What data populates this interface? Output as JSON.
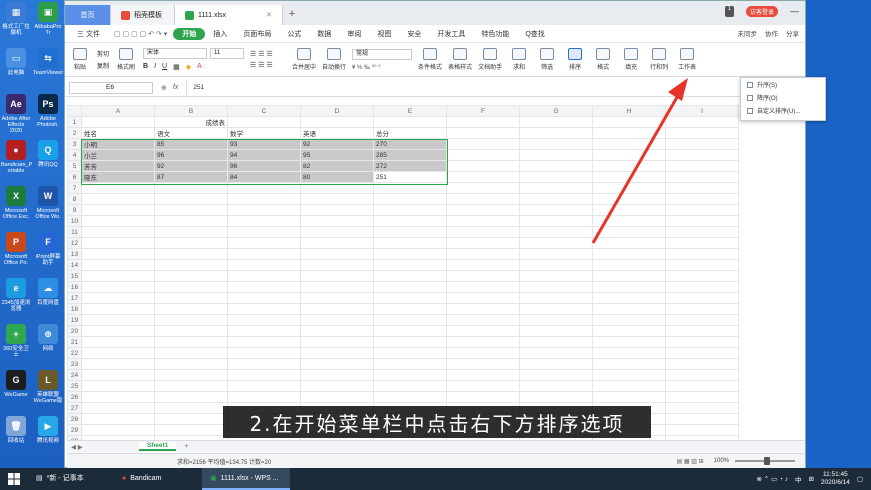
{
  "desktop_icons": [
    {
      "label": "格式工厂拉摄机",
      "color": "#3a7bd5",
      "glyph": "▦"
    },
    {
      "label": "AlibabaPro Tr",
      "color": "#2c9e4b",
      "glyph": "▣"
    },
    {
      "label": "此电脑",
      "color": "#4a90e2",
      "glyph": "▭"
    },
    {
      "label": "TeamViewer",
      "color": "#1f6fd1",
      "glyph": "⇆"
    },
    {
      "label": "Adobe After Effects 2020",
      "color": "#3b2a6e",
      "glyph": "Ae"
    },
    {
      "label": "Adobe Photosh.",
      "color": "#0b2a4a",
      "glyph": "Ps"
    },
    {
      "label": "Bandicam_P ortable",
      "color": "#b32020",
      "glyph": "●"
    },
    {
      "label": "腾讯QQ",
      "color": "#1aa0e8",
      "glyph": "Q"
    },
    {
      "label": "Microsoft Office Exc.",
      "color": "#1e7b3e",
      "glyph": "X"
    },
    {
      "label": "Microsoft Office Wo.",
      "color": "#1f55a8",
      "glyph": "W"
    },
    {
      "label": "Microsoft Office Po.",
      "color": "#c84a1c",
      "glyph": "P"
    },
    {
      "label": "iPoint屏幕助手",
      "color": "#2466d4",
      "glyph": "F"
    },
    {
      "label": "2345加速浏览器",
      "color": "#1b9be0",
      "glyph": "e"
    },
    {
      "label": "百度网盘",
      "color": "#2d8fe3",
      "glyph": "☁"
    },
    {
      "label": "360安全卫士",
      "color": "#2fa84f",
      "glyph": "+"
    },
    {
      "label": "网络",
      "color": "#3e8ad8",
      "glyph": "⊕"
    },
    {
      "label": "WeGame",
      "color": "#1d1d1d",
      "glyph": "G"
    },
    {
      "label": "英雄联盟 WeGame版",
      "color": "#6a5a2a",
      "glyph": "L"
    },
    {
      "label": "回收站",
      "color": "#7ea6d6",
      "glyph": "🗑"
    },
    {
      "label": "腾讯视频",
      "color": "#27a6e8",
      "glyph": "▶"
    }
  ],
  "app": {
    "tabs": [
      {
        "label": "首页"
      },
      {
        "label": "稻壳模板"
      },
      {
        "label": "1111.xlsx"
      }
    ],
    "window_badge": "1",
    "login_label": "访客登录",
    "menu": {
      "file": "三 文件",
      "items": [
        "开始",
        "插入",
        "页面布局",
        "公式",
        "数据",
        "审阅",
        "视图",
        "安全",
        "开发工具",
        "特色功能",
        "Q查找"
      ],
      "right": [
        "未同步",
        "协作",
        "分享"
      ]
    },
    "toolbar": {
      "paste": "粘贴",
      "cut": "剪切",
      "copy": "复制",
      "format_painter": "格式刷",
      "font": "宋体",
      "size": "11",
      "number_format": "常规",
      "merge": "合并居中",
      "wrap": "自动换行",
      "conditional": "条件格式",
      "table_style": "表格样式",
      "doc_helper": "文档助手",
      "sum": "求和",
      "filter": "筛选",
      "sort": "排序",
      "format": "格式",
      "fill": "填充",
      "row_col": "行和列",
      "worksheet": "工作表"
    },
    "formula_bar": {
      "cell_ref": "E6",
      "fx": "fx",
      "value": "251"
    }
  },
  "sheet": {
    "columns": [
      "A",
      "B",
      "C",
      "D",
      "E",
      "F",
      "G",
      "H",
      "I"
    ],
    "rows": [
      [
        "",
        "成绩表",
        "",
        "",
        "",
        "",
        "",
        "",
        ""
      ],
      [
        "姓名",
        "语文",
        "数学",
        "英语",
        "总分",
        "",
        "",
        "",
        ""
      ],
      [
        "小明",
        "85",
        "93",
        "92",
        "270",
        "",
        "",
        "",
        ""
      ],
      [
        "小兰",
        "96",
        "94",
        "95",
        "285",
        "",
        "",
        "",
        ""
      ],
      [
        "芳芳",
        "92",
        "96",
        "82",
        "272",
        "",
        "",
        "",
        ""
      ],
      [
        "晓东",
        "87",
        "84",
        "80",
        "251",
        "",
        "",
        "",
        ""
      ]
    ],
    "tab_name": "Sheet1"
  },
  "sort_menu": {
    "items": [
      "升序(S)",
      "降序(O)",
      "自定义排序(U)..."
    ]
  },
  "status_bar": {
    "summary": "求和=2156  平均值=134.75  计数=20",
    "zoom": "100%"
  },
  "caption": "2.在开始菜单栏中点击右下方排序选项",
  "taskbar": {
    "items": [
      "*新 - 记事本",
      "Bandicam",
      "1111.xlsx - WPS ..."
    ],
    "ime": "中",
    "time": "11:51:45",
    "date": "2020/6/14"
  },
  "colors": {
    "accent_green": "#2ea44f",
    "arrow_red": "#e8332a",
    "home_tab_blue": "#5b8fe8"
  }
}
